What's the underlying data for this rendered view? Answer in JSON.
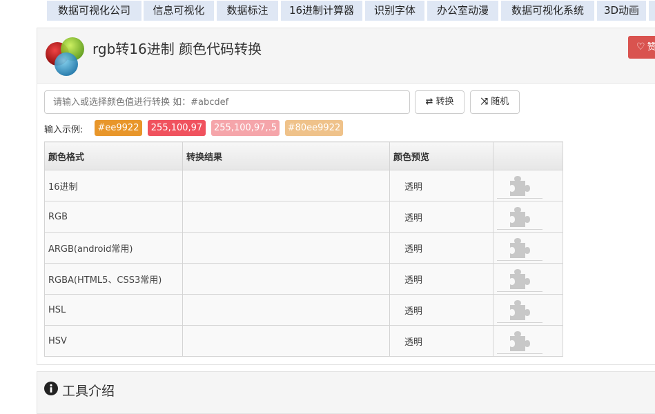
{
  "nav": {
    "tabs": [
      "数据可视化公司",
      "信息可视化",
      "数据标注",
      "16进制计算器",
      "识别字体",
      "办公室动漫",
      "数据可视化系统",
      "3D动画"
    ]
  },
  "header": {
    "title": "rgb转16进制 颜色代码转换",
    "like_label": "赞"
  },
  "converter": {
    "placeholder": "请输入或选择颜色值进行转换 如：#abcdef",
    "convert_label": "转换",
    "random_label": "随机",
    "examples_label": "输入示例:",
    "examples": [
      {
        "text": "#ee9922",
        "color": "#e8962a"
      },
      {
        "text": "255,100,97",
        "color": "#f0525e"
      },
      {
        "text": "255,100,97,.5",
        "color": "#f5a5aa"
      },
      {
        "text": "#80ee9922",
        "color": "#efc28a"
      }
    ]
  },
  "table": {
    "headers": [
      "颜色格式",
      "转换结果",
      "颜色预览",
      ""
    ],
    "rows": [
      {
        "format": "16进制",
        "result": "",
        "preview": "透明"
      },
      {
        "format": "RGB",
        "result": "",
        "preview": "透明"
      },
      {
        "format": "ARGB(android常用)",
        "result": "",
        "preview": "透明"
      },
      {
        "format": "RGBA(HTML5、CSS3常用)",
        "result": "",
        "preview": "透明"
      },
      {
        "format": "HSL",
        "result": "",
        "preview": "透明"
      },
      {
        "format": "HSV",
        "result": "",
        "preview": "透明"
      }
    ]
  },
  "section": {
    "title": "工具介绍"
  },
  "icons": {
    "convert": "exchange-icon",
    "random": "shuffle-icon",
    "copy": "puzzle-icon",
    "like": "heart-icon",
    "info": "info-circle-icon"
  }
}
